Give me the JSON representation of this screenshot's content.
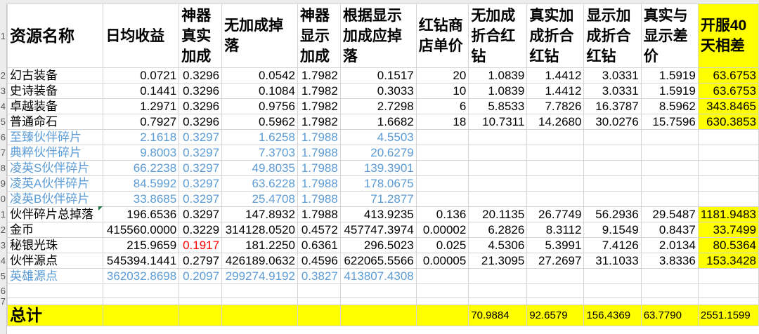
{
  "headers": [
    "资源名称",
    "日均收益",
    "神器真实加成",
    "无加成掉落",
    "神器显示加成",
    "根据显示加成应掉落",
    "红钻商店单价",
    "无加成折合红钻",
    "真实加成折合红钻",
    "显示加成折合红钻",
    "真实与显示差价",
    "开服40天相差"
  ],
  "rows": [
    {
      "cells": [
        "幻古装备",
        "0.0721",
        "0.3296",
        "0.0542",
        "1.7982",
        "0.1517",
        "20",
        "1.0839",
        "1.4412",
        "3.0331",
        "1.5919",
        "63.6753"
      ],
      "style": "normal"
    },
    {
      "cells": [
        "史诗装备",
        "0.1441",
        "0.3296",
        "0.1084",
        "1.7982",
        "0.3033",
        "10",
        "1.0839",
        "1.4412",
        "3.0331",
        "1.5919",
        "63.6753"
      ],
      "style": "normal"
    },
    {
      "cells": [
        "卓越装备",
        "1.2971",
        "0.3296",
        "0.9756",
        "1.7982",
        "2.7298",
        "6",
        "5.8533",
        "7.7826",
        "16.3787",
        "8.5962",
        "343.8465"
      ],
      "style": "normal"
    },
    {
      "cells": [
        "普通命石",
        "0.7927",
        "0.3296",
        "0.5962",
        "1.7982",
        "1.6682",
        "18",
        "10.7311",
        "14.2680",
        "30.0276",
        "15.7596",
        "630.3853"
      ],
      "style": "normal"
    },
    {
      "cells": [
        "至臻伙伴碎片",
        "2.1618",
        "0.3297",
        "1.6258",
        "1.7988",
        "4.5503",
        "",
        "",
        "",
        "",
        "",
        ""
      ],
      "style": "blue"
    },
    {
      "cells": [
        "典粹伙伴碎片",
        "9.8003",
        "0.3297",
        "7.3703",
        "1.7988",
        "20.6279",
        "",
        "",
        "",
        "",
        "",
        ""
      ],
      "style": "blue"
    },
    {
      "cells": [
        "凌英S伙伴碎片",
        "66.2238",
        "0.3297",
        "49.8035",
        "1.7988",
        "139.3901",
        "",
        "",
        "",
        "",
        "",
        ""
      ],
      "style": "blue"
    },
    {
      "cells": [
        "凌英A伙伴碎片",
        "84.5992",
        "0.3297",
        "63.6228",
        "1.7988",
        "178.0675",
        "",
        "",
        "",
        "",
        "",
        ""
      ],
      "style": "blue"
    },
    {
      "cells": [
        "凌英B伙伴碎片",
        "33.8685",
        "0.3297",
        "25.4708",
        "1.7988",
        "71.2877",
        "",
        "",
        "",
        "",
        "",
        ""
      ],
      "style": "blue"
    },
    {
      "cells": [
        "伙伴碎片总掉落",
        "196.6536",
        "0.3297",
        "147.8932",
        "1.7988",
        "413.9235",
        "0.136",
        "20.1135",
        "26.7749",
        "56.2936",
        "29.5487",
        "1181.9483"
      ],
      "style": "normal"
    },
    {
      "cells": [
        "金币",
        "415560.0000",
        "0.3229",
        "314128.0520",
        "0.4572",
        "457747.3974",
        "0.00002",
        "6.2826",
        "8.3112",
        "9.1549",
        "0.8437",
        "33.7499"
      ],
      "style": "normal"
    },
    {
      "cells": [
        "秘银光珠",
        "215.9659",
        "0.1917",
        "181.2250",
        "0.6361",
        "296.5023",
        "0.025",
        "4.5306",
        "5.3991",
        "7.4126",
        "2.0134",
        "80.5364"
      ],
      "style": "normal",
      "red_col": 2
    },
    {
      "cells": [
        "伙伴源点",
        "545394.1441",
        "0.2797",
        "426189.0632",
        "0.4596",
        "622065.5566",
        "0.00005",
        "21.3095",
        "27.2697",
        "31.1033",
        "3.8336",
        "153.3428"
      ],
      "style": "normal"
    },
    {
      "cells": [
        "英雄源点",
        "362032.8698",
        "0.2097",
        "299274.9192",
        "0.3827",
        "413807.4308",
        "",
        "",
        "",
        "",
        "",
        ""
      ],
      "style": "blue"
    }
  ],
  "total": {
    "cells": [
      "总计",
      "",
      "",
      "",
      "",
      "",
      "",
      "70.9884",
      "92.6579",
      "156.4369",
      "63.7790",
      "2551.1599"
    ]
  },
  "row_numbers": [
    "1",
    "2",
    "3",
    "4",
    "5",
    "6",
    "7",
    "8",
    "9",
    "0",
    "1",
    "2",
    "3",
    "4",
    "5",
    "6",
    "7"
  ],
  "colors": {
    "highlight": "#ffff00",
    "blue_text": "#5b9bd5",
    "red_text": "#ff0000",
    "grid": "#d4d4d4"
  }
}
